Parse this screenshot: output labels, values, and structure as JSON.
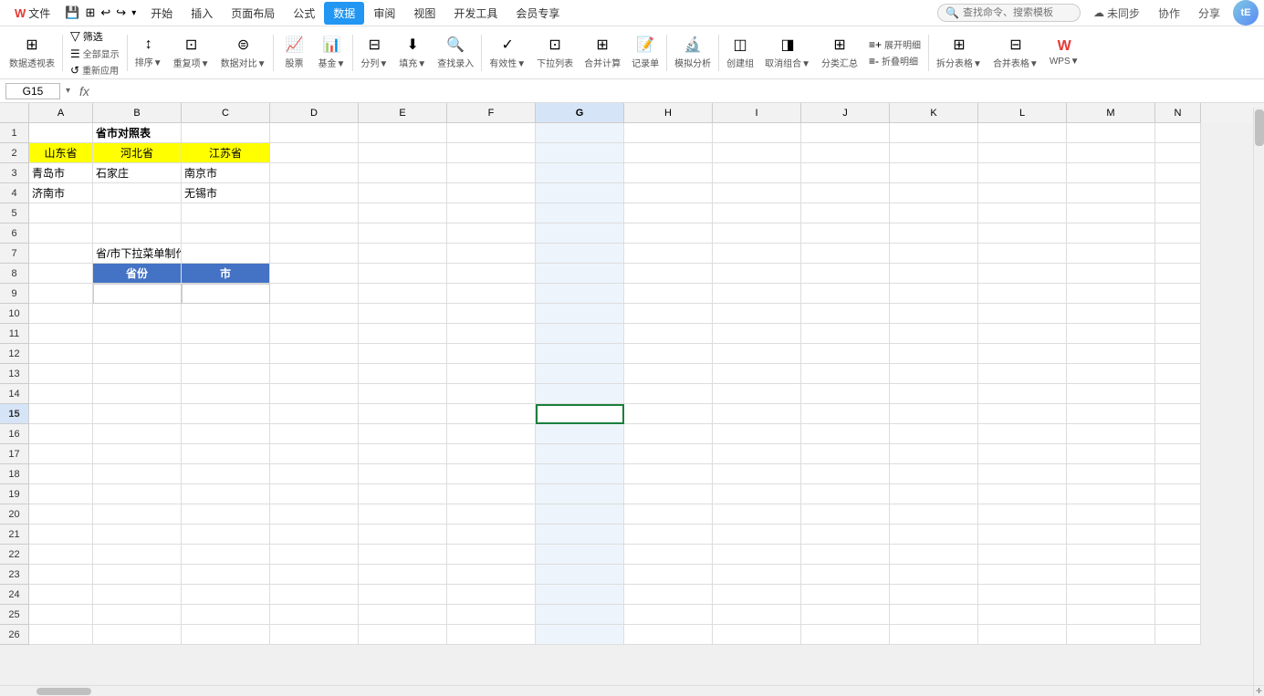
{
  "titleBar": {
    "fileName": "文件",
    "menuItems": [
      "文件",
      "插入",
      "页面布局",
      "公式",
      "数据",
      "审阅",
      "视图",
      "开发工具",
      "会员专享"
    ],
    "activeTab": "数据",
    "searchPlaceholder": "查找命令、搜索模板",
    "syncLabel": "未同步",
    "coopLabel": "协作",
    "shareLabel": "分享",
    "avatarText": "tE"
  },
  "toolbar": {
    "groups": [
      {
        "icon": "⊞",
        "label": "数据透视表"
      },
      {
        "icon": "▽",
        "label": "筛选"
      },
      {
        "icon": "▽▣",
        "label": "全部显示"
      },
      {
        "icon": "↺",
        "label": "重新应用"
      },
      {
        "icon": "↕",
        "label": "排序▼"
      },
      {
        "icon": "⧉",
        "label": "重复项▼"
      },
      {
        "icon": "⊜",
        "label": "数据对比▼"
      },
      {
        "icon": "📈",
        "label": "股票"
      },
      {
        "icon": "📊",
        "label": "基金▼"
      },
      {
        "icon": "⊟",
        "label": "分列▼"
      },
      {
        "icon": "⬇",
        "label": "填充▼"
      },
      {
        "icon": "🔍",
        "label": "查找录入"
      },
      {
        "icon": "✓",
        "label": "有效性▼"
      },
      {
        "icon": "⊡",
        "label": "下拉列表"
      },
      {
        "icon": "⊞",
        "label": "合并计算"
      },
      {
        "icon": "📝",
        "label": "记录单"
      },
      {
        "icon": "◫",
        "label": "创建组"
      },
      {
        "icon": "◨",
        "label": "取消组合▼"
      },
      {
        "icon": "⊞",
        "label": "分类汇总"
      },
      {
        "icon": "≡+",
        "label": "展开明细"
      },
      {
        "icon": "≡-",
        "label": "折叠明细"
      },
      {
        "icon": "⊞",
        "label": "拆分表格▼"
      },
      {
        "icon": "⊟",
        "label": "合并表格▼"
      },
      {
        "icon": "W",
        "label": "WPS▼"
      },
      {
        "icon": "🔬",
        "label": "模拟分析"
      }
    ]
  },
  "formulaBar": {
    "cellRef": "G15",
    "formulaContent": ""
  },
  "columns": [
    "A",
    "B",
    "C",
    "D",
    "E",
    "F",
    "G",
    "H",
    "I",
    "J",
    "K",
    "L",
    "M",
    "N"
  ],
  "activeCell": {
    "row": 15,
    "col": "G"
  },
  "rows": [
    {
      "num": 1,
      "cells": {
        "A": "",
        "B": "省市对照表",
        "C": "",
        "D": "",
        "E": "",
        "F": "",
        "G": "",
        "H": "",
        "I": "",
        "J": "",
        "K": "",
        "L": "",
        "M": "",
        "N": ""
      }
    },
    {
      "num": 2,
      "cells": {
        "A": "山东省",
        "B": "河北省",
        "C": "江苏省",
        "D": "",
        "E": "",
        "F": "",
        "G": "",
        "H": "",
        "I": "",
        "J": "",
        "K": "",
        "L": "",
        "M": "",
        "N": ""
      }
    },
    {
      "num": 3,
      "cells": {
        "A": "青岛市",
        "B": "石家庄",
        "C": "南京市",
        "D": "",
        "E": "",
        "F": "",
        "G": "",
        "H": "",
        "I": "",
        "J": "",
        "K": "",
        "L": "",
        "M": "",
        "N": ""
      }
    },
    {
      "num": 4,
      "cells": {
        "A": "济南市",
        "B": "",
        "C": "无锡市",
        "D": "",
        "E": "",
        "F": "",
        "G": "",
        "H": "",
        "I": "",
        "J": "",
        "K": "",
        "L": "",
        "M": "",
        "N": ""
      }
    },
    {
      "num": 5,
      "cells": {
        "A": "",
        "B": "",
        "C": "",
        "D": "",
        "E": "",
        "F": "",
        "G": "",
        "H": "",
        "I": "",
        "J": "",
        "K": "",
        "L": "",
        "M": "",
        "N": ""
      }
    },
    {
      "num": 6,
      "cells": {
        "A": "",
        "B": "",
        "C": "",
        "D": "",
        "E": "",
        "F": "",
        "G": "",
        "H": "",
        "I": "",
        "J": "",
        "K": "",
        "L": "",
        "M": "",
        "N": ""
      }
    },
    {
      "num": 7,
      "cells": {
        "A": "",
        "B": "省/市下拉菜单制作",
        "C": "",
        "D": "",
        "E": "",
        "F": "",
        "G": "",
        "H": "",
        "I": "",
        "J": "",
        "K": "",
        "L": "",
        "M": "",
        "N": ""
      }
    },
    {
      "num": 8,
      "cells": {
        "A": "",
        "B": "省份",
        "C": "市",
        "D": "",
        "E": "",
        "F": "",
        "G": "",
        "H": "",
        "I": "",
        "J": "",
        "K": "",
        "L": "",
        "M": "",
        "N": ""
      }
    },
    {
      "num": 9,
      "cells": {
        "A": "",
        "B": "",
        "C": "",
        "D": "",
        "E": "",
        "F": "",
        "G": "",
        "H": "",
        "I": "",
        "J": "",
        "K": "",
        "L": "",
        "M": "",
        "N": ""
      }
    },
    {
      "num": 10,
      "cells": {
        "A": "",
        "B": "",
        "C": "",
        "D": "",
        "E": "",
        "F": "",
        "G": "",
        "H": "",
        "I": "",
        "J": "",
        "K": "",
        "L": "",
        "M": "",
        "N": ""
      }
    },
    {
      "num": 11,
      "cells": {
        "A": "",
        "B": "",
        "C": "",
        "D": "",
        "E": "",
        "F": "",
        "G": "",
        "H": "",
        "I": "",
        "J": "",
        "K": "",
        "L": "",
        "M": "",
        "N": ""
      }
    },
    {
      "num": 12,
      "cells": {
        "A": "",
        "B": "",
        "C": "",
        "D": "",
        "E": "",
        "F": "",
        "G": "",
        "H": "",
        "I": "",
        "J": "",
        "K": "",
        "L": "",
        "M": "",
        "N": ""
      }
    },
    {
      "num": 13,
      "cells": {
        "A": "",
        "B": "",
        "C": "",
        "D": "",
        "E": "",
        "F": "",
        "G": "",
        "H": "",
        "I": "",
        "J": "",
        "K": "",
        "L": "",
        "M": "",
        "N": ""
      }
    },
    {
      "num": 14,
      "cells": {
        "A": "",
        "B": "",
        "C": "",
        "D": "",
        "E": "",
        "F": "",
        "G": "",
        "H": "",
        "I": "",
        "J": "",
        "K": "",
        "L": "",
        "M": "",
        "N": ""
      }
    },
    {
      "num": 15,
      "cells": {
        "A": "",
        "B": "",
        "C": "",
        "D": "",
        "E": "",
        "F": "",
        "G": "",
        "H": "",
        "I": "",
        "J": "",
        "K": "",
        "L": "",
        "M": "",
        "N": ""
      }
    },
    {
      "num": 16,
      "cells": {
        "A": "",
        "B": "",
        "C": "",
        "D": "",
        "E": "",
        "F": "",
        "G": "",
        "H": "",
        "I": "",
        "J": "",
        "K": "",
        "L": "",
        "M": "",
        "N": ""
      }
    },
    {
      "num": 17,
      "cells": {
        "A": "",
        "B": "",
        "C": "",
        "D": "",
        "E": "",
        "F": "",
        "G": "",
        "H": "",
        "I": "",
        "J": "",
        "K": "",
        "L": "",
        "M": "",
        "N": ""
      }
    },
    {
      "num": 18,
      "cells": {
        "A": "",
        "B": "",
        "C": "",
        "D": "",
        "E": "",
        "F": "",
        "G": "",
        "H": "",
        "I": "",
        "J": "",
        "K": "",
        "L": "",
        "M": "",
        "N": ""
      }
    },
    {
      "num": 19,
      "cells": {
        "A": "",
        "B": "",
        "C": "",
        "D": "",
        "E": "",
        "F": "",
        "G": "",
        "H": "",
        "I": "",
        "J": "",
        "K": "",
        "L": "",
        "M": "",
        "N": ""
      }
    },
    {
      "num": 20,
      "cells": {
        "A": "",
        "B": "",
        "C": "",
        "D": "",
        "E": "",
        "F": "",
        "G": "",
        "H": "",
        "I": "",
        "J": "",
        "K": "",
        "L": "",
        "M": "",
        "N": ""
      }
    },
    {
      "num": 21,
      "cells": {
        "A": "",
        "B": "",
        "C": "",
        "D": "",
        "E": "",
        "F": "",
        "G": "",
        "H": "",
        "I": "",
        "J": "",
        "K": "",
        "L": "",
        "M": "",
        "N": ""
      }
    },
    {
      "num": 22,
      "cells": {
        "A": "",
        "B": "",
        "C": "",
        "D": "",
        "E": "",
        "F": "",
        "G": "",
        "H": "",
        "I": "",
        "J": "",
        "K": "",
        "L": "",
        "M": "",
        "N": ""
      }
    },
    {
      "num": 23,
      "cells": {
        "A": "",
        "B": "",
        "C": "",
        "D": "",
        "E": "",
        "F": "",
        "G": "",
        "H": "",
        "I": "",
        "J": "",
        "K": "",
        "L": "",
        "M": "",
        "N": ""
      }
    },
    {
      "num": 24,
      "cells": {
        "A": "",
        "B": "",
        "C": "",
        "D": "",
        "E": "",
        "F": "",
        "G": "",
        "H": "",
        "I": "",
        "J": "",
        "K": "",
        "L": "",
        "M": "",
        "N": ""
      }
    },
    {
      "num": 25,
      "cells": {
        "A": "",
        "B": "",
        "C": "",
        "D": "",
        "E": "",
        "F": "",
        "G": "",
        "H": "",
        "I": "",
        "J": "",
        "K": "",
        "L": "",
        "M": "",
        "N": ""
      }
    },
    {
      "num": 26,
      "cells": {
        "A": "",
        "B": "",
        "C": "",
        "D": "",
        "E": "",
        "F": "",
        "G": "",
        "H": "",
        "I": "",
        "J": "",
        "K": "",
        "L": "",
        "M": "",
        "N": ""
      }
    }
  ],
  "cellStyles": {
    "B1": "bold",
    "A2": "yellow",
    "B2": "yellow",
    "C2": "yellow",
    "B8": "blue-header",
    "C8": "blue-header"
  },
  "colors": {
    "yellow": "#FFFF00",
    "blueHeader": "#4472C4",
    "activeCell": "#1a7f3c",
    "selectedCol": "#eef4fb"
  }
}
